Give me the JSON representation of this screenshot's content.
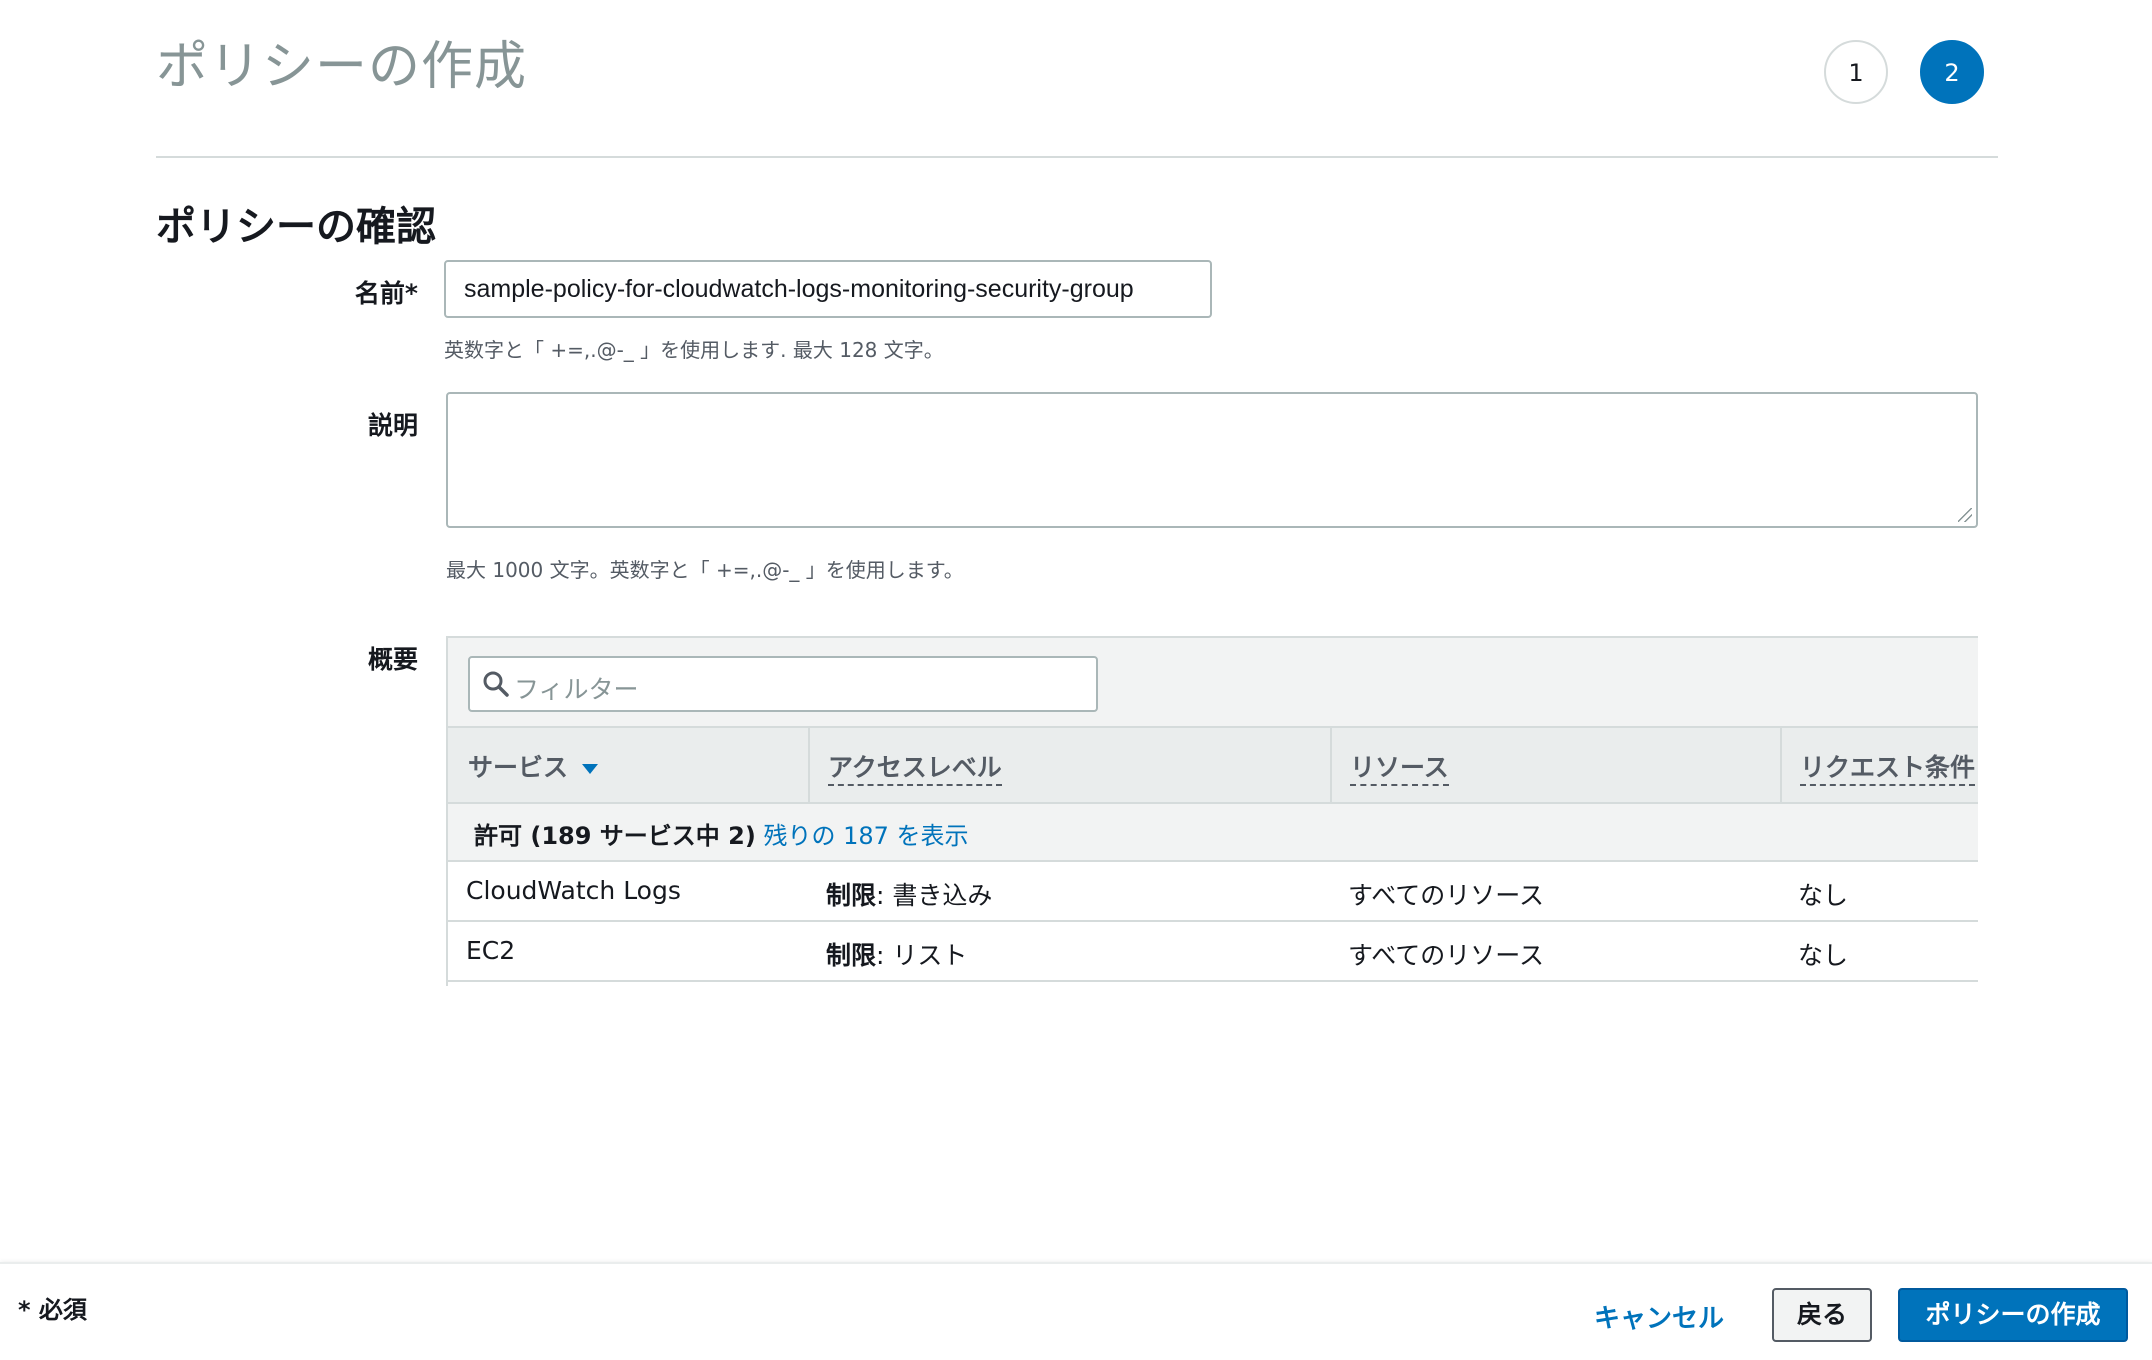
{
  "page": {
    "title": "ポリシーの作成"
  },
  "steps": [
    "1",
    "2"
  ],
  "section": {
    "title": "ポリシーの確認"
  },
  "form": {
    "name_label": "名前*",
    "name_value": "sample-policy-for-cloudwatch-logs-monitoring-security-group",
    "name_hint": "英数字と「 +=,.@-_ 」を使用します. 最大 128 文字。",
    "desc_label": "説明",
    "desc_value": "",
    "desc_hint": "最大 1000 文字。英数字と「 +=,.@-_ 」を使用します。",
    "summary_label": "概要"
  },
  "summary": {
    "filter_placeholder": "フィルター",
    "columns": [
      "サービス",
      "アクセスレベル",
      "リソース",
      "リクエスト条件"
    ],
    "group": {
      "label": "許可 (189 サービス中 2)",
      "link": "残りの 187 を表示"
    },
    "rows": [
      {
        "service": "CloudWatch Logs",
        "access_prefix": "制限",
        "access_value": ": 書き込み",
        "resource": "すべてのリソース",
        "condition": "なし"
      },
      {
        "service": "EC2",
        "access_prefix": "制限",
        "access_value": ": リスト",
        "resource": "すべてのリソース",
        "condition": "なし"
      }
    ]
  },
  "footer": {
    "required_note": "* 必須",
    "cancel_label": "キャンセル",
    "back_label": "戻る",
    "create_label": "ポリシーの作成"
  },
  "colors": {
    "accent": "#0073bb",
    "muted_title": "#879596",
    "border": "#d5dbdb"
  }
}
